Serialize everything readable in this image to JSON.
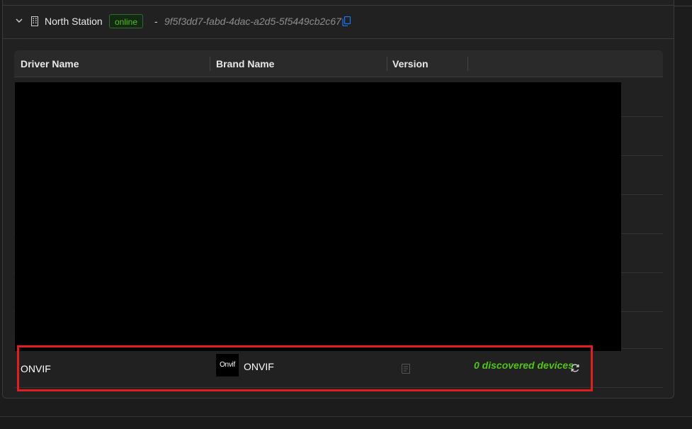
{
  "station": {
    "name": "North Station",
    "status": "online",
    "separator": "-",
    "id": "9f5f3dd7-fabd-4dac-a2d5-5f5449cb2c67"
  },
  "table": {
    "columns": [
      "Driver Name",
      "Brand Name",
      "Version",
      ""
    ],
    "rows": [
      {
        "driver_name": "ONVIF",
        "brand_logo_text": "Onvif",
        "brand_name": "ONVIF",
        "version": "",
        "discovered": "0 discovered devices"
      }
    ]
  },
  "icons": {
    "expand": "chevron-down-icon",
    "station": "building-icon",
    "copy": "copy-icon",
    "version": "document-icon",
    "refresh": "refresh-icon"
  },
  "colors": {
    "status_green": "#52c41a",
    "highlight_red": "#e01e1e",
    "link_blue": "#1677ff"
  }
}
